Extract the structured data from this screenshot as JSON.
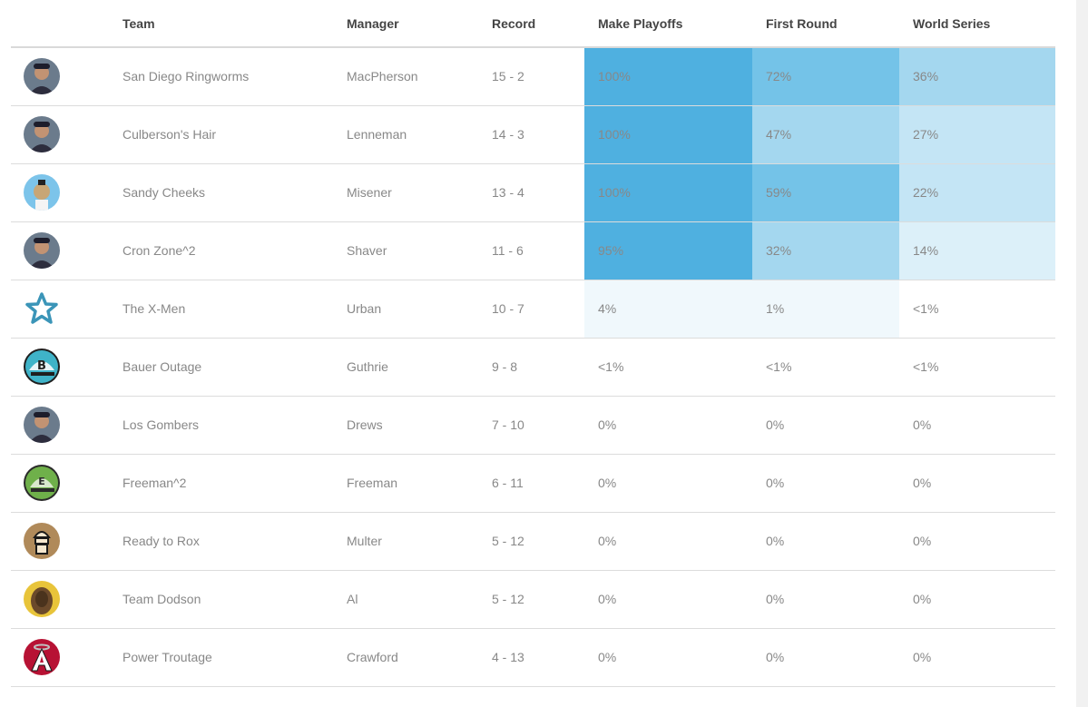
{
  "table": {
    "headers": {
      "team": "Team",
      "manager": "Manager",
      "record": "Record",
      "make_playoffs": "Make Playoffs",
      "first_round": "First Round",
      "world_series": "World Series"
    },
    "rows": [
      {
        "team": "San Diego Ringworms",
        "manager": "MacPherson",
        "record": "15 - 2",
        "make_playoffs": "100%",
        "first_round": "72%",
        "world_series": "36%",
        "logo": "player-photo-icon"
      },
      {
        "team": "Culberson's Hair",
        "manager": "Lenneman",
        "record": "14 - 3",
        "make_playoffs": "100%",
        "first_round": "47%",
        "world_series": "27%",
        "logo": "player-photo-icon"
      },
      {
        "team": "Sandy Cheeks",
        "manager": "Misener",
        "record": "13 - 4",
        "make_playoffs": "100%",
        "first_round": "59%",
        "world_series": "22%",
        "logo": "cartoon-mascot-icon"
      },
      {
        "team": "Cron Zone^2",
        "manager": "Shaver",
        "record": "11 - 6",
        "make_playoffs": "95%",
        "first_round": "32%",
        "world_series": "14%",
        "logo": "player-photo-icon"
      },
      {
        "team": "The X-Men",
        "manager": "Urban",
        "record": "10 - 7",
        "make_playoffs": "4%",
        "first_round": "1%",
        "world_series": "<1%",
        "logo": "star-icon"
      },
      {
        "team": "Bauer Outage",
        "manager": "Guthrie",
        "record": "9 - 8",
        "make_playoffs": "<1%",
        "first_round": "<1%",
        "world_series": "<1%",
        "logo": "cap-b-icon"
      },
      {
        "team": "Los Gombers",
        "manager": "Drews",
        "record": "7 - 10",
        "make_playoffs": "0%",
        "first_round": "0%",
        "world_series": "0%",
        "logo": "player-photo-icon"
      },
      {
        "team": "Freeman^2",
        "manager": "Freeman",
        "record": "6 - 11",
        "make_playoffs": "0%",
        "first_round": "0%",
        "world_series": "0%",
        "logo": "cap-e-icon"
      },
      {
        "team": "Ready to Rox",
        "manager": "Multer",
        "record": "5 - 12",
        "make_playoffs": "0%",
        "first_round": "0%",
        "world_series": "0%",
        "logo": "ice-cream-icon"
      },
      {
        "team": "Team Dodson",
        "manager": "Al",
        "record": "5 - 12",
        "make_playoffs": "0%",
        "first_round": "0%",
        "world_series": "0%",
        "logo": "wookiee-icon"
      },
      {
        "team": "Power Troutage",
        "manager": "Crawford",
        "record": "4 - 13",
        "make_playoffs": "0%",
        "first_round": "0%",
        "world_series": "0%",
        "logo": "angels-a-icon"
      }
    ]
  },
  "heat_colors": [
    "#4fb0e0",
    "#74c3e8",
    "#a4d7ef",
    "#c4e5f5",
    "#dcf0f9",
    "#f0f8fc"
  ]
}
